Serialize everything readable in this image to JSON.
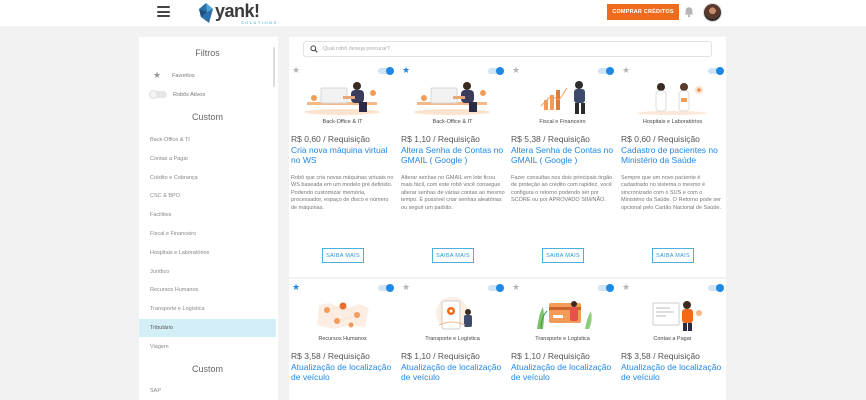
{
  "header": {
    "logo_text": "yank!",
    "logo_sub": "SOLUTIONS",
    "credits_button": "COMPRAR CRÉDITOS"
  },
  "sidebar": {
    "title": "Filtros",
    "favorites_label": "Favoritos",
    "active_robots_label": "Robôs Ativos",
    "section1_title": "Custom",
    "section2_title": "Custom",
    "items": [
      "Back-Office & TI",
      "Contas a Pagar",
      "Crédito e Cobrança",
      "CSC & BPO",
      "Facilities",
      "Fiscal e Financeiro",
      "Hospitais e Laboratórios",
      "Jurídico",
      "Recursos Humanos",
      "Transporte e Logística",
      "Tributário",
      "Viagem"
    ],
    "items_after": [
      "SAP"
    ],
    "active_item": "Tributário"
  },
  "search": {
    "placeholder": "Qual robô deseja procurar?"
  },
  "cards": [
    {
      "favorite": false,
      "enabled": true,
      "category": "Back-Office & IT",
      "price": "R$ 0,60 / Requisição",
      "title": "Cria nova máquina virtual no WS",
      "description": "Robô que cria novas máquinas virtuais no WS baseada em um modelo pré definido. Podendo customizar memória, processador, espaço de disco e número de máquinas.",
      "button": "SAIBA MAIS",
      "illustration": "person-laptop"
    },
    {
      "favorite": true,
      "enabled": true,
      "category": "Back-Office & IT",
      "price": "R$ 1,10 / Requisição",
      "title": "Altera Senha de Contas no GMAIL ( Google )",
      "description": "Alterar senhas no GMAIL em lote ficou mais fácil, com este robô você consegue alterar senhas de várias contas ao mesmo tempo. É possível criar senhas aleatórias ou seguir um padrão.",
      "button": "SAIBA MAIS",
      "illustration": "person-laptop"
    },
    {
      "favorite": false,
      "enabled": true,
      "category": "Fiscal e Financeiro",
      "price": "R$ 5,38 / Requisição",
      "title": "Altera Senha de Contas no GMAIL ( Google )",
      "description": "Fazer consultas nos dois principais órgão de proteção ao crédito com rapidez, você configura o retorno podendo ser por SCORE ou por APROVADO SIM/NÃO.",
      "button": "SAIBA MAIS",
      "illustration": "finance"
    },
    {
      "favorite": false,
      "enabled": true,
      "category": "Hospitais e Laboratórios",
      "price": "R$ 0,60 / Requisição",
      "title": "Cadastro de pacientes no Ministério da Saúde",
      "description": "Sempre que um novo paciente é cadastrado no sistema o mesmo é sincronizado com o SUS e com o Ministério da Saúde. O Retorno pode ser opcional pelo Cartão Nacional de Saúde.",
      "button": "SAIBA MAIS",
      "illustration": "doctors"
    },
    {
      "favorite": true,
      "enabled": true,
      "category": "Recursos Humanos",
      "price": "R$ 3,58 / Requisição",
      "title": "Atualização de localização de veículo",
      "illustration": "map-pins"
    },
    {
      "favorite": false,
      "enabled": true,
      "category": "Transporte e Logística",
      "price": "R$ 1,10 / Requisição",
      "title": "Atualização de localização de veículo",
      "illustration": "phone-map"
    },
    {
      "favorite": false,
      "enabled": true,
      "category": "Transporte e Logística",
      "price": "R$ 1,10 / Requisição",
      "title": "Atualização de localização de veículo",
      "illustration": "card-plants"
    },
    {
      "favorite": false,
      "enabled": true,
      "category": "Contas a Pagar",
      "price": "R$ 3,58 / Requisição",
      "title": "Atualização de localização de veículo",
      "illustration": "payment"
    }
  ],
  "colors": {
    "accent": "#1e88e5",
    "orange": "#f26b1d",
    "active_bg": "#d3eef7"
  }
}
